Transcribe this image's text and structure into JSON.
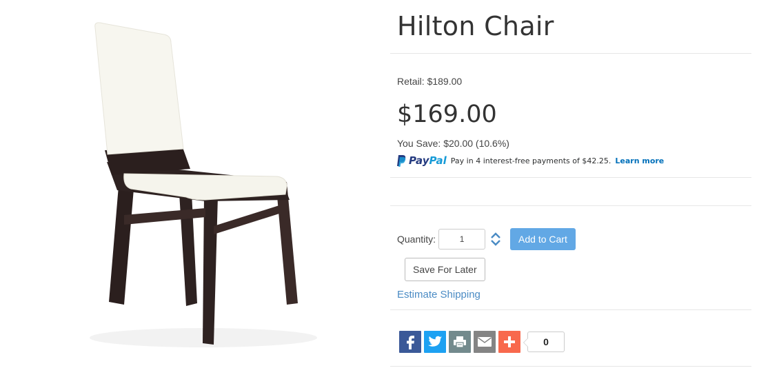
{
  "product": {
    "title": "Hilton Chair",
    "image_alt": "Hilton Chair product photo"
  },
  "pricing": {
    "retail": "Retail: $189.00",
    "price": "$169.00",
    "you_save": "You Save: $20.00 (10.6%)"
  },
  "paypal": {
    "logo_pay": "Pay",
    "logo_pal": "Pal",
    "message": "Pay in 4 interest-free payments of $42.25.",
    "learn_more": "Learn more"
  },
  "cart": {
    "quantity_label": "Quantity:",
    "quantity_value": "1",
    "add_to_cart": "Add to Cart",
    "save_for_later": "Save For Later",
    "estimate_shipping": "Estimate Shipping"
  },
  "share": {
    "icons": [
      "facebook-icon",
      "twitter-icon",
      "print-icon",
      "email-icon",
      "add-icon"
    ],
    "count": "0"
  },
  "colors": {
    "accent_button": "#62a8e5",
    "link": "#4a8bc4",
    "facebook": "#3b5998",
    "twitter": "#1da1f2",
    "print": "#738a8d",
    "email": "#848484",
    "addthis": "#f8694d"
  }
}
